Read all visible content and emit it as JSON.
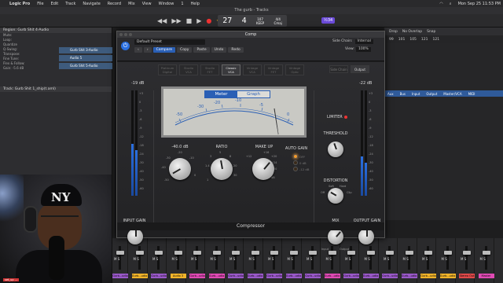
{
  "menubar": {
    "apple": "",
    "app": "Logic Pro",
    "items": [
      "File",
      "Edit",
      "Track",
      "Navigate",
      "Record",
      "Mix",
      "View",
      "Window",
      "1",
      "Help"
    ],
    "datetime": "Mon Sep 25  11:53 PM"
  },
  "window": {
    "title": "The gurb - Tracks"
  },
  "lcd": {
    "bar": "27",
    "beat": "4",
    "tempo": "107",
    "tempo_label": "KEEP",
    "sig": "4/4",
    "key": "Cmaj"
  },
  "toolbar": {
    "badge": "½34"
  },
  "inspector": {
    "region_header": "Region: Gurb Shit 4-Audio",
    "track_header": "Track: Gurb Shit 1_ship(t.aml)",
    "rows": [
      "Mute:",
      "Loop:",
      "Quantize",
      "Q-Swing:",
      "Transpose:",
      "Fine Tune:",
      "Flex & Follow:",
      "Gain:"
    ],
    "gain_value": "-5.6 dB",
    "tracks": [
      "Gurb Shit 3-Audio",
      "Audio 5",
      "Gurb Shit 5-Audio"
    ]
  },
  "tracks_area": {
    "toolbar": [
      "Drop",
      "No Overlap",
      "Snap"
    ],
    "ruler": [
      "99",
      "101",
      "105",
      "121",
      "121"
    ],
    "routing": [
      "Aux",
      "Bus",
      "Input",
      "Output",
      "Master/VCA",
      "MIDI"
    ]
  },
  "mixer": {
    "strips": [
      {
        "name": "Gurb...udio",
        "color": "#9a59c9"
      },
      {
        "name": "Gurb...udio",
        "color": "#f0b32a"
      },
      {
        "name": "Gurb...udio",
        "color": "#9a59c9"
      },
      {
        "name": "Audio 3",
        "color": "#f0b32a"
      },
      {
        "name": "Gurb...udio",
        "color": "#e04ab4"
      },
      {
        "name": "Gurb...udio",
        "color": "#e04ab4"
      },
      {
        "name": "Gurb...udio",
        "color": "#9a59c9"
      },
      {
        "name": "Gurb...udio",
        "color": "#9a59c9"
      },
      {
        "name": "Gurb...udio",
        "color": "#9a59c9"
      },
      {
        "name": "Gurb...udio",
        "color": "#9a59c9"
      },
      {
        "name": "Gurb...udio",
        "color": "#9a59c9"
      },
      {
        "name": "Gurb...udio",
        "color": "#e04ab4"
      },
      {
        "name": "Gurb...udio",
        "color": "#9a59c9"
      },
      {
        "name": "Gurb...udio",
        "color": "#9a59c9"
      },
      {
        "name": "Gurb...udio",
        "color": "#9a59c9"
      },
      {
        "name": "Gurb...udio",
        "color": "#9a59c9"
      },
      {
        "name": "Gurb...udio",
        "color": "#f0b32a"
      },
      {
        "name": "Gurb...udio",
        "color": "#f0b32a"
      },
      {
        "name": "Stereo Out",
        "color": "#e04a4a"
      },
      {
        "name": "Master",
        "color": "#e04ab4"
      }
    ],
    "ms_label": "M S",
    "bottom_tag": "set_up ..."
  },
  "plugin": {
    "window_title": "Comp",
    "preset": "Default Preset",
    "buttons": [
      "Compare",
      "Copy",
      "Paste",
      "Undo",
      "Redo"
    ],
    "side_chain_label": "Side Chain:",
    "side_chain_value": "Internal",
    "view_label": "View:",
    "view_value": "100%",
    "models": [
      {
        "line1": "Platinum",
        "line2": "Digital",
        "active": false
      },
      {
        "line1": "Studio",
        "line2": "VCA",
        "active": false
      },
      {
        "line1": "Studio",
        "line2": "FET",
        "active": false
      },
      {
        "line1": "Classic",
        "line2": "VCA",
        "active": true
      },
      {
        "line1": "Vintage",
        "line2": "VCA",
        "active": false
      },
      {
        "line1": "Vintage",
        "line2": "FET",
        "active": false
      },
      {
        "line1": "Vintage",
        "line2": "Opto",
        "active": false
      }
    ],
    "sc_buttons": [
      "Side Chain",
      "Output"
    ],
    "meter_tabs": [
      "Meter",
      "Graph"
    ],
    "meter_scale": [
      "-50",
      "-30",
      "-20",
      "-10",
      "-5",
      "0"
    ],
    "input_meter_top": "-19 dB",
    "output_meter_top": "-22 dB",
    "scale_left": [
      "+3",
      "0",
      "-3",
      "-6",
      "-9",
      "-12",
      "-18",
      "-24",
      "-30",
      "-40",
      "-50",
      "-60"
    ],
    "scale_right": [
      "+3",
      "0",
      "-3",
      "-6",
      "-9",
      "-12",
      "-18",
      "-24",
      "-30",
      "-40",
      "-50",
      "-60"
    ],
    "threshold_value": "-40.0 dB",
    "threshold_ticks": [
      "-30",
      "-20",
      "-10",
      "-40",
      "-50",
      "0"
    ],
    "ratio_label": "RATIO",
    "ratio_ticks": [
      "3",
      "5",
      "8",
      "20",
      "30",
      "1.4",
      "1"
    ],
    "makeup_label": "MAKE UP",
    "makeup_ticks": [
      "+12",
      "+16",
      "+20",
      "+24",
      "+30",
      "dB"
    ],
    "autogain_label": "AUTO GAIN",
    "autogain_opts": [
      "OFF",
      "0 dB",
      "-12 dB"
    ],
    "limiter_label": "LIMITER",
    "threshold_label": "THRESHOLD",
    "distortion_label": "DISTORTION",
    "distortion_opts": [
      "Off",
      "Soft",
      "Hard",
      "Clip"
    ],
    "mix_label": "MIX",
    "mix_opts": [
      "Input",
      "Output",
      "1:1"
    ],
    "input_gain_label": "INPUT GAIN",
    "output_gain_label": "OUTPUT GAIN",
    "footer": "Compressor",
    "colors": {
      "accent": "#2a5fb5",
      "meter_bg": "#c9c9c4",
      "autogain_led": "#f59a2a"
    }
  }
}
